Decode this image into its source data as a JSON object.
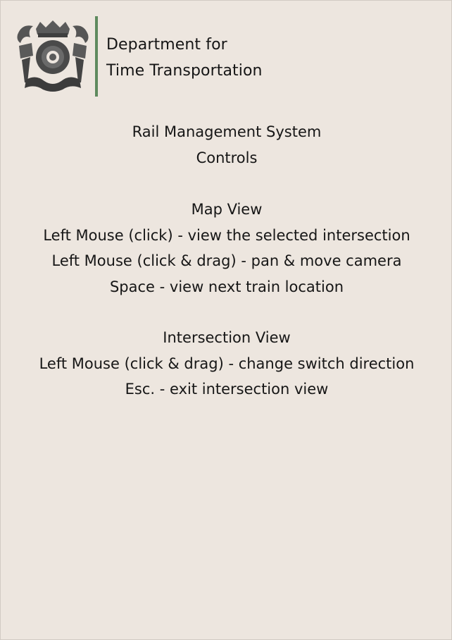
{
  "header": {
    "emblem_icon": "crowned-railway-crest-icon",
    "dept_line1": "Department for",
    "dept_line2": "Time Transportation",
    "divider_color": "#5e8a5e"
  },
  "title": {
    "line1": "Rail Management System",
    "line2": "Controls"
  },
  "map_view": {
    "heading": "Map View",
    "controls": [
      "Left Mouse (click) - view the selected intersection",
      "Left Mouse (click & drag) - pan & move camera",
      "Space - view next train location"
    ]
  },
  "intersection_view": {
    "heading": "Intersection View",
    "controls": [
      "Left Mouse (click & drag) - change switch direction",
      "Esc. - exit intersection view"
    ]
  },
  "colors": {
    "background": "#ede6df",
    "text": "#161616",
    "emblem": "#4a4a4a"
  }
}
